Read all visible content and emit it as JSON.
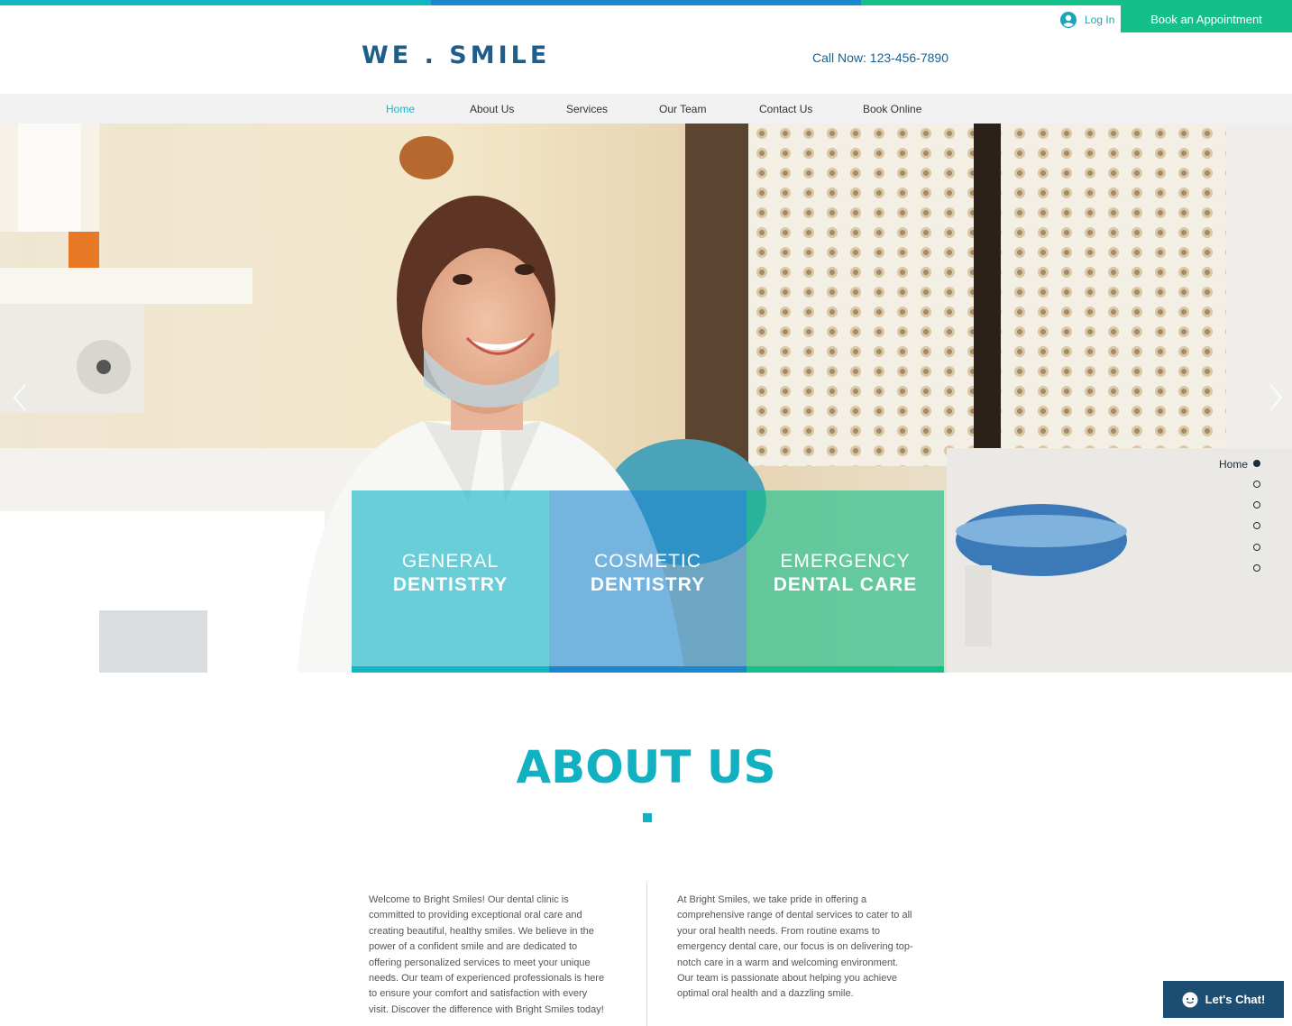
{
  "colors": {
    "teal": "#11b5c4",
    "blue": "#1c87cf",
    "green": "#14bf8a",
    "navy": "#1d5e8c",
    "about_teal": "#12b1c1",
    "chat_bg": "#1c4e74"
  },
  "header": {
    "login_label": "Log In",
    "login_icon": "user-avatar-icon",
    "book_button": "Book an Appointment",
    "logo": "WE . SMILE",
    "phone": "Call Now: 123-456-7890"
  },
  "nav": {
    "items": [
      {
        "label": "Home",
        "active": true
      },
      {
        "label": "About Us"
      },
      {
        "label": "Services"
      },
      {
        "label": "Our Team"
      },
      {
        "label": "Contact Us"
      },
      {
        "label": "Book Online"
      }
    ]
  },
  "hero": {
    "prev_icon": "chevron-left-icon",
    "next_icon": "chevron-right-icon",
    "anchor_label": "Home",
    "tiles": [
      {
        "line1": "GENERAL",
        "line2": "DENTISTRY"
      },
      {
        "line1": "COSMETIC",
        "line2": "DENTISTRY"
      },
      {
        "line1": "EMERGENCY",
        "line2": "DENTAL CARE"
      }
    ]
  },
  "about": {
    "title": "ABOUT US",
    "left_text": "Welcome to Bright Smiles! Our dental clinic is committed to providing exceptional oral care and creating beautiful, healthy smiles. We believe in the power of a confident smile and are dedicated to offering personalized services to meet your unique needs. Our team of experienced professionals is here to ensure your comfort and satisfaction with every visit. Discover the difference with Bright Smiles today!",
    "right_text": "At Bright Smiles, we take pride in offering a comprehensive range of dental services to cater to all your oral health needs. From routine exams to emergency dental care, our focus is on delivering top-notch care in a warm and welcoming environment. Our team is passionate about helping you achieve optimal oral health and a dazzling smile."
  },
  "chat": {
    "label": "Let's Chat!",
    "icon": "chat-bubble-icon"
  }
}
